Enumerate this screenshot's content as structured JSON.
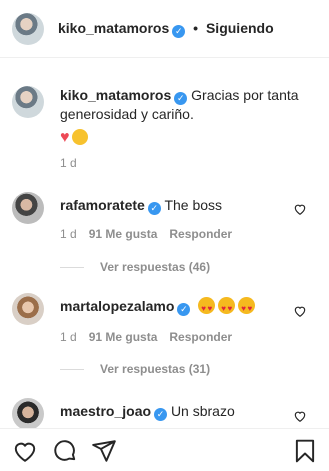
{
  "header": {
    "username": "kiko_matamoros",
    "separator": "•",
    "follow_label": "Siguiendo"
  },
  "caption": {
    "username": "kiko_matamoros",
    "text": "Gracias por tanta generosidad y cariño.",
    "time": "1 d"
  },
  "comments": [
    {
      "username": "rafamoratete",
      "text": "The boss",
      "time": "1 d",
      "likes": "91 Me gusta",
      "reply_label": "Responder",
      "view_replies": "Ver respuestas (46)"
    },
    {
      "username": "martalopezalamo",
      "text": "",
      "time": "1 d",
      "likes": "91 Me gusta",
      "reply_label": "Responder",
      "view_replies": "Ver respuestas (31)"
    },
    {
      "username": "maestro_joao",
      "text": "Un sbrazo"
    }
  ],
  "icons": {
    "like": "heart-icon",
    "comment": "comment-icon",
    "share": "share-icon",
    "save": "bookmark-icon"
  },
  "colors": {
    "verified": "#3897f0",
    "muted": "#8e8e8e",
    "text": "#262626"
  }
}
